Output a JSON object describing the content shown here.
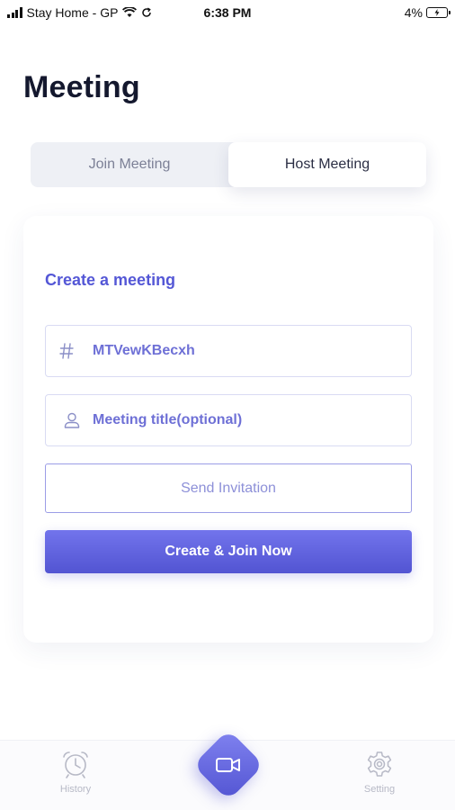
{
  "status_bar": {
    "carrier": "Stay Home - GP",
    "time": "6:38 PM",
    "battery": "4%"
  },
  "page": {
    "title": "Meeting"
  },
  "tabs": [
    {
      "label": "Join Meeting",
      "active": false
    },
    {
      "label": "Host Meeting",
      "active": true
    }
  ],
  "create": {
    "section_title": "Create a meeting",
    "meeting_code": "MTVewKBecxh",
    "title_placeholder": "Meeting title(optional)",
    "send_invitation_label": "Send Invitation",
    "create_join_label": "Create & Join Now"
  },
  "bottom_nav": {
    "history_label": "History",
    "setting_label": "Setting"
  },
  "icons": {
    "code": "hash-icon",
    "title": "user-icon",
    "history": "alarm-clock-icon",
    "center": "video-camera-icon",
    "setting": "gear-icon"
  },
  "colors": {
    "accent": "#5457d6",
    "accent_light": "#7274ec",
    "border": "#d9dbf3",
    "tab_bg": "#eef0f5"
  }
}
